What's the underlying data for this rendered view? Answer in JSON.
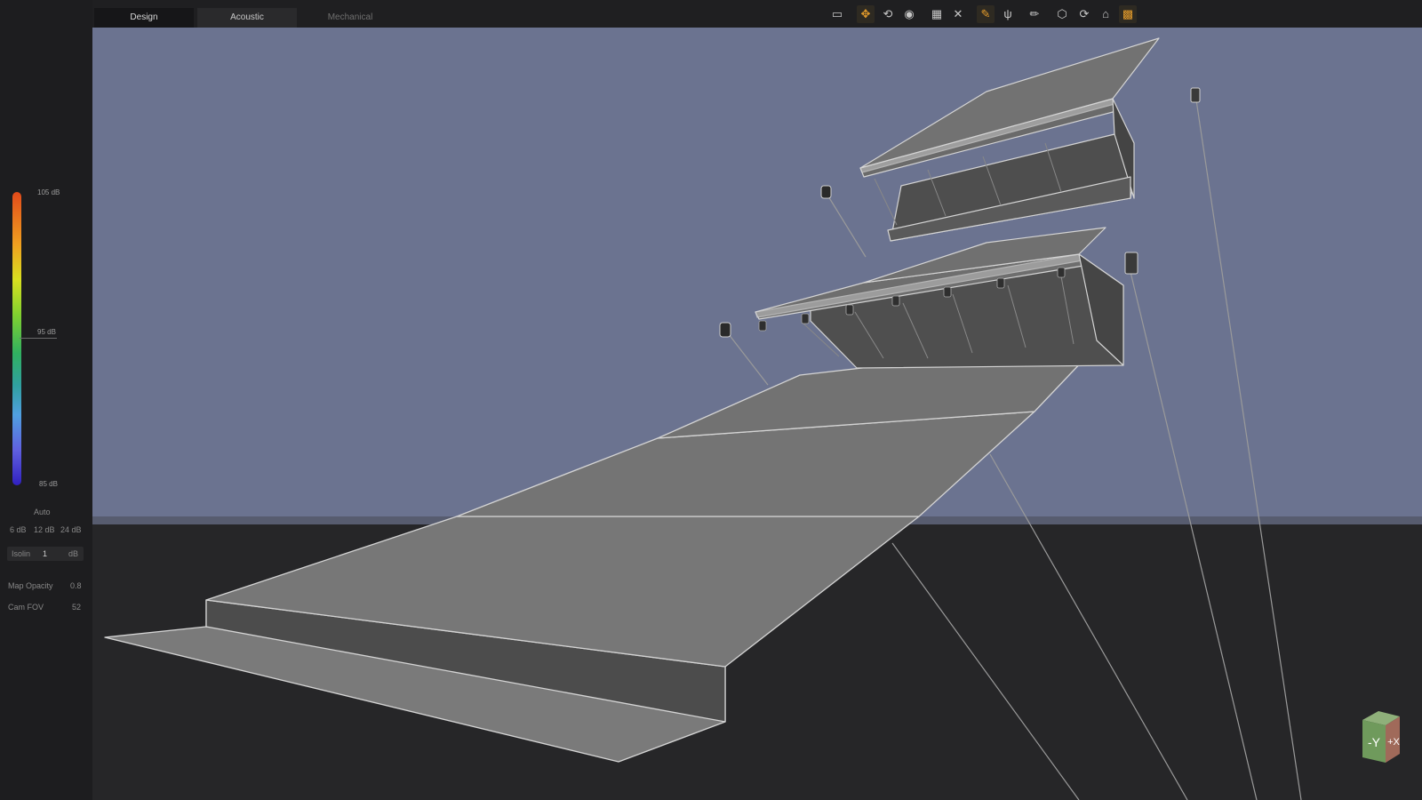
{
  "tabs": [
    {
      "label": "Design",
      "state": "active"
    },
    {
      "label": "Acoustic",
      "state": "hover"
    },
    {
      "label": "Mechanical",
      "state": "inactive"
    }
  ],
  "toolbar": {
    "icons": [
      "select-icon",
      "move-icon",
      "rotate-icon",
      "globe-icon",
      "grid-icon",
      "close-x-icon",
      "pen-icon",
      "fork-icon",
      "brush-icon",
      "box-3d-icon",
      "refresh-zoom-icon",
      "home-icon",
      "chart-icon"
    ]
  },
  "colorbar": {
    "max_label": "105 dB",
    "mid_label": "95 dB",
    "min_label": "85 dB",
    "mode": "Auto",
    "steps": [
      "6 dB",
      "12 dB",
      "24 dB"
    ]
  },
  "scale": {
    "label": "Isolin",
    "value": "1",
    "unit": "dB"
  },
  "settings": {
    "map_opacity_label": "Map Opacity",
    "map_opacity_value": "0.8",
    "cam_fov_label": "Cam FOV",
    "cam_fov_value": "52"
  },
  "viewcube": {
    "front_label": "-Y",
    "side_label": "+X"
  },
  "colors": {
    "sky": "#6b7390",
    "ground": "#262628",
    "geometry": "#747474",
    "edges": "#d4d4d4",
    "accent": "#e39b2b"
  }
}
